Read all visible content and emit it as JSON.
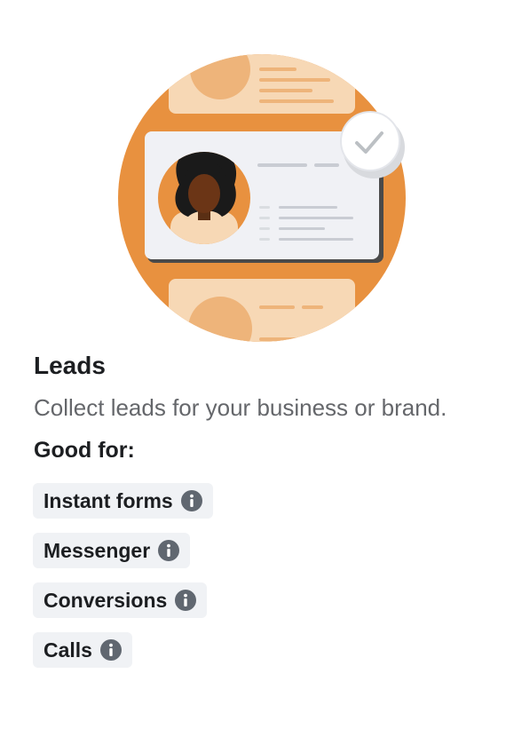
{
  "objective": {
    "title": "Leads",
    "description": "Collect leads for your business or brand.",
    "good_for_label": "Good for:"
  },
  "tags": [
    {
      "label": "Instant forms",
      "icon": "info-icon"
    },
    {
      "label": "Messenger",
      "icon": "info-icon"
    },
    {
      "label": "Conversions",
      "icon": "info-icon"
    },
    {
      "label": "Calls",
      "icon": "info-icon"
    }
  ],
  "colors": {
    "accent_orange": "#e8913f",
    "card_peach": "#f7d8b5",
    "tag_background": "#f0f2f5",
    "text_primary": "#1c1e21",
    "text_secondary": "#65676b",
    "icon_gray": "#606770"
  },
  "illustration": {
    "name": "leads-illustration",
    "icons": [
      "person-avatar",
      "checkmark-icon"
    ]
  }
}
